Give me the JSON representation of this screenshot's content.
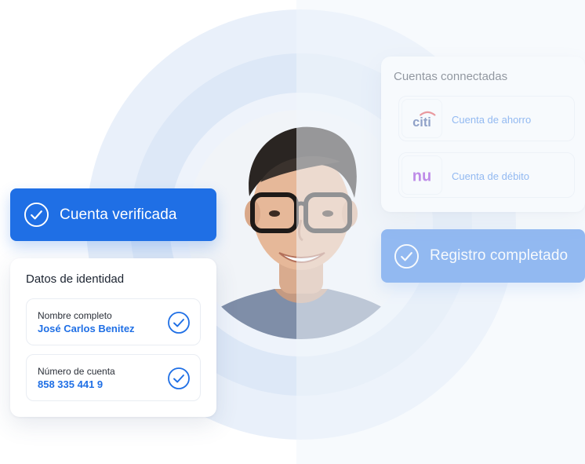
{
  "identity_card": {
    "title": "Datos de identidad",
    "fields": [
      {
        "label": "Nombre completo",
        "value": "José Carlos Benitez",
        "icon": "check-circle-icon"
      },
      {
        "label": "Número de cuenta",
        "value": "858 335 441 9",
        "icon": "check-circle-icon"
      }
    ]
  },
  "badges": {
    "verified": {
      "label": "Cuenta verificada",
      "icon": "check-circle-icon"
    },
    "registered": {
      "label": "Registro completado",
      "icon": "check-circle-icon"
    }
  },
  "accounts_card": {
    "title": "Cuentas connectadas",
    "accounts": [
      {
        "logo_text": "citi",
        "label": "Cuenta de ahorro"
      },
      {
        "logo_text": "nu",
        "label": "Cuenta de débito"
      }
    ]
  },
  "colors": {
    "accent": "#1f6fe5",
    "citi_blue": "#1a3a8a",
    "citi_arc": "#e0282e",
    "nu_purple": "#820ad1",
    "ring_light": "#e9f0fa"
  }
}
